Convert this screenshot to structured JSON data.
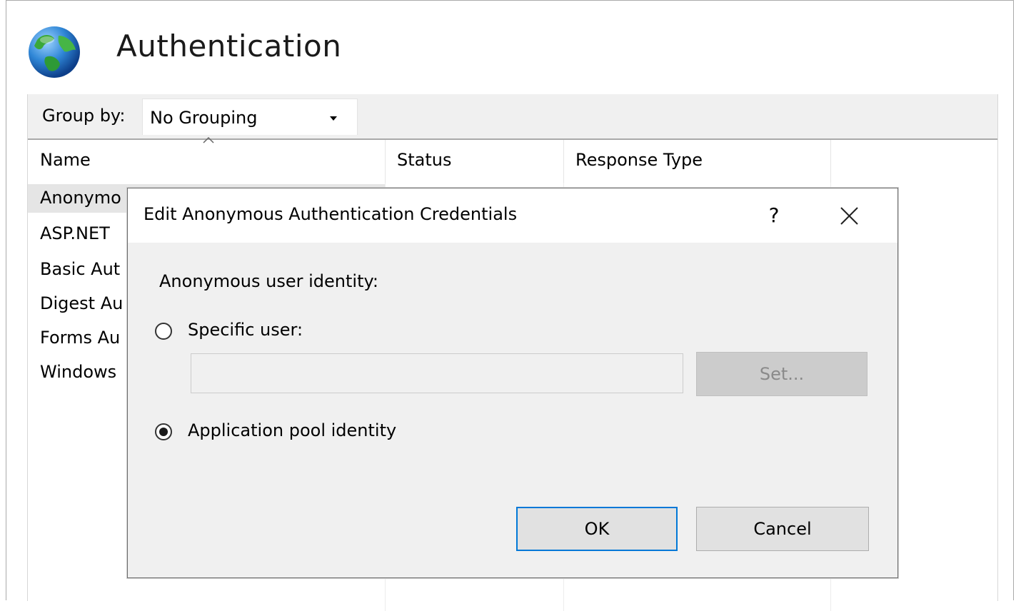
{
  "page": {
    "title": "Authentication",
    "icon": "globe-icon"
  },
  "toolbar": {
    "group_by_label": "Group by:",
    "group_by_value": "No Grouping"
  },
  "table": {
    "columns": [
      "Name",
      "Status",
      "Response Type"
    ],
    "rows": [
      {
        "name": "Anonymous Authentication",
        "visible_text": "Anonymo",
        "selected": true
      },
      {
        "name": "ASP.NET Impersonation",
        "visible_text": "ASP.NET",
        "selected": false
      },
      {
        "name": "Basic Authentication",
        "visible_text": "Basic Aut",
        "selected": false
      },
      {
        "name": "Digest Authentication",
        "visible_text": "Digest Au",
        "selected": false
      },
      {
        "name": "Forms Authentication",
        "visible_text": "Forms Au",
        "selected": false
      },
      {
        "name": "Windows Authentication",
        "visible_text": "Windows",
        "selected": false
      }
    ]
  },
  "dialog": {
    "title": "Edit Anonymous Authentication Credentials",
    "help_label": "?",
    "identity_label": "Anonymous user identity:",
    "specific_user_label": "Specific user:",
    "specific_user_value": "",
    "set_button": "Set...",
    "app_pool_label": "Application pool identity",
    "selected_option": "app_pool",
    "ok_button": "OK",
    "cancel_button": "Cancel"
  },
  "colors": {
    "accent": "#0078d7",
    "dialog_bg": "#f0f0f0",
    "selected_row": "#e5e5e5"
  }
}
